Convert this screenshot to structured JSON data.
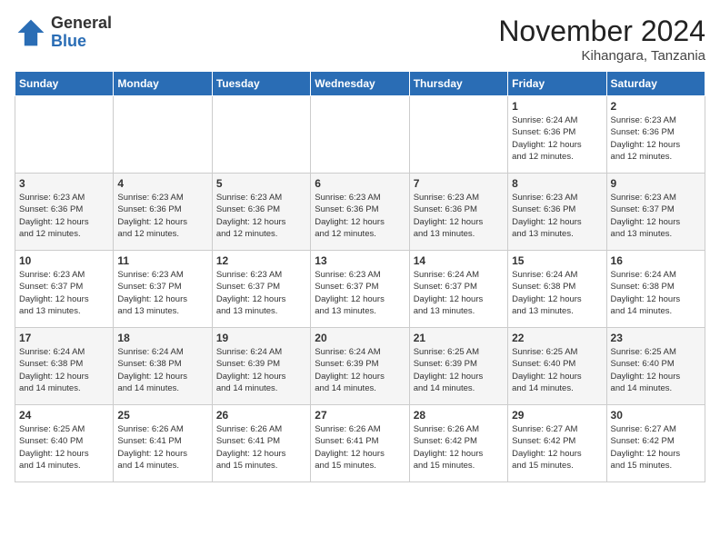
{
  "logo": {
    "general": "General",
    "blue": "Blue"
  },
  "header": {
    "month_year": "November 2024",
    "location": "Kihangara, Tanzania"
  },
  "weekdays": [
    "Sunday",
    "Monday",
    "Tuesday",
    "Wednesday",
    "Thursday",
    "Friday",
    "Saturday"
  ],
  "weeks": [
    [
      {
        "day": "",
        "info": ""
      },
      {
        "day": "",
        "info": ""
      },
      {
        "day": "",
        "info": ""
      },
      {
        "day": "",
        "info": ""
      },
      {
        "day": "",
        "info": ""
      },
      {
        "day": "1",
        "info": "Sunrise: 6:24 AM\nSunset: 6:36 PM\nDaylight: 12 hours\nand 12 minutes."
      },
      {
        "day": "2",
        "info": "Sunrise: 6:23 AM\nSunset: 6:36 PM\nDaylight: 12 hours\nand 12 minutes."
      }
    ],
    [
      {
        "day": "3",
        "info": "Sunrise: 6:23 AM\nSunset: 6:36 PM\nDaylight: 12 hours\nand 12 minutes."
      },
      {
        "day": "4",
        "info": "Sunrise: 6:23 AM\nSunset: 6:36 PM\nDaylight: 12 hours\nand 12 minutes."
      },
      {
        "day": "5",
        "info": "Sunrise: 6:23 AM\nSunset: 6:36 PM\nDaylight: 12 hours\nand 12 minutes."
      },
      {
        "day": "6",
        "info": "Sunrise: 6:23 AM\nSunset: 6:36 PM\nDaylight: 12 hours\nand 12 minutes."
      },
      {
        "day": "7",
        "info": "Sunrise: 6:23 AM\nSunset: 6:36 PM\nDaylight: 12 hours\nand 13 minutes."
      },
      {
        "day": "8",
        "info": "Sunrise: 6:23 AM\nSunset: 6:36 PM\nDaylight: 12 hours\nand 13 minutes."
      },
      {
        "day": "9",
        "info": "Sunrise: 6:23 AM\nSunset: 6:37 PM\nDaylight: 12 hours\nand 13 minutes."
      }
    ],
    [
      {
        "day": "10",
        "info": "Sunrise: 6:23 AM\nSunset: 6:37 PM\nDaylight: 12 hours\nand 13 minutes."
      },
      {
        "day": "11",
        "info": "Sunrise: 6:23 AM\nSunset: 6:37 PM\nDaylight: 12 hours\nand 13 minutes."
      },
      {
        "day": "12",
        "info": "Sunrise: 6:23 AM\nSunset: 6:37 PM\nDaylight: 12 hours\nand 13 minutes."
      },
      {
        "day": "13",
        "info": "Sunrise: 6:23 AM\nSunset: 6:37 PM\nDaylight: 12 hours\nand 13 minutes."
      },
      {
        "day": "14",
        "info": "Sunrise: 6:24 AM\nSunset: 6:37 PM\nDaylight: 12 hours\nand 13 minutes."
      },
      {
        "day": "15",
        "info": "Sunrise: 6:24 AM\nSunset: 6:38 PM\nDaylight: 12 hours\nand 13 minutes."
      },
      {
        "day": "16",
        "info": "Sunrise: 6:24 AM\nSunset: 6:38 PM\nDaylight: 12 hours\nand 14 minutes."
      }
    ],
    [
      {
        "day": "17",
        "info": "Sunrise: 6:24 AM\nSunset: 6:38 PM\nDaylight: 12 hours\nand 14 minutes."
      },
      {
        "day": "18",
        "info": "Sunrise: 6:24 AM\nSunset: 6:38 PM\nDaylight: 12 hours\nand 14 minutes."
      },
      {
        "day": "19",
        "info": "Sunrise: 6:24 AM\nSunset: 6:39 PM\nDaylight: 12 hours\nand 14 minutes."
      },
      {
        "day": "20",
        "info": "Sunrise: 6:24 AM\nSunset: 6:39 PM\nDaylight: 12 hours\nand 14 minutes."
      },
      {
        "day": "21",
        "info": "Sunrise: 6:25 AM\nSunset: 6:39 PM\nDaylight: 12 hours\nand 14 minutes."
      },
      {
        "day": "22",
        "info": "Sunrise: 6:25 AM\nSunset: 6:40 PM\nDaylight: 12 hours\nand 14 minutes."
      },
      {
        "day": "23",
        "info": "Sunrise: 6:25 AM\nSunset: 6:40 PM\nDaylight: 12 hours\nand 14 minutes."
      }
    ],
    [
      {
        "day": "24",
        "info": "Sunrise: 6:25 AM\nSunset: 6:40 PM\nDaylight: 12 hours\nand 14 minutes."
      },
      {
        "day": "25",
        "info": "Sunrise: 6:26 AM\nSunset: 6:41 PM\nDaylight: 12 hours\nand 14 minutes."
      },
      {
        "day": "26",
        "info": "Sunrise: 6:26 AM\nSunset: 6:41 PM\nDaylight: 12 hours\nand 15 minutes."
      },
      {
        "day": "27",
        "info": "Sunrise: 6:26 AM\nSunset: 6:41 PM\nDaylight: 12 hours\nand 15 minutes."
      },
      {
        "day": "28",
        "info": "Sunrise: 6:26 AM\nSunset: 6:42 PM\nDaylight: 12 hours\nand 15 minutes."
      },
      {
        "day": "29",
        "info": "Sunrise: 6:27 AM\nSunset: 6:42 PM\nDaylight: 12 hours\nand 15 minutes."
      },
      {
        "day": "30",
        "info": "Sunrise: 6:27 AM\nSunset: 6:42 PM\nDaylight: 12 hours\nand 15 minutes."
      }
    ]
  ]
}
